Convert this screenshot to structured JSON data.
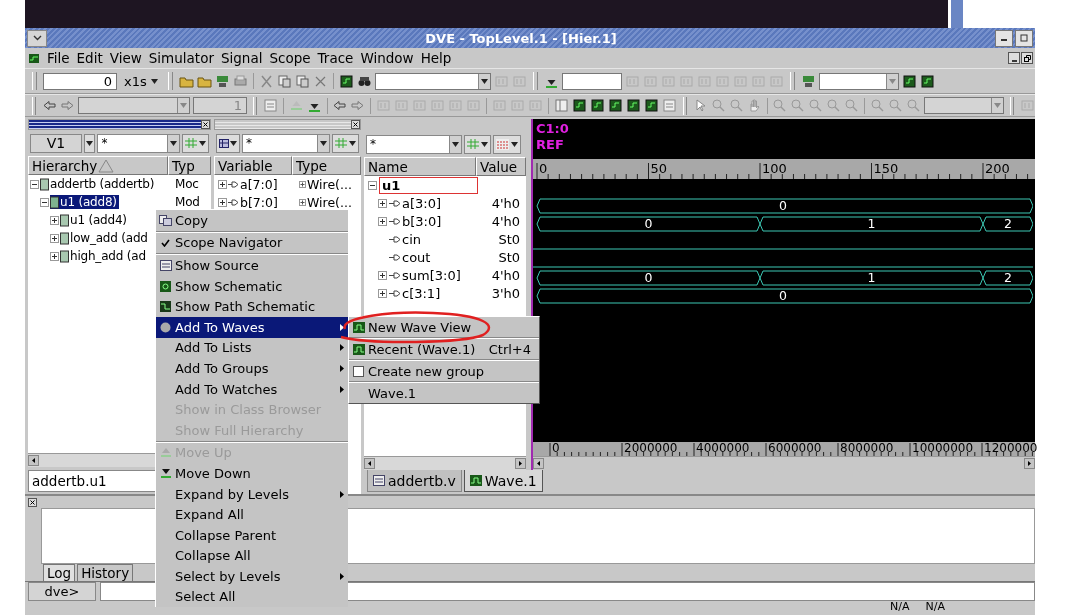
{
  "window": {
    "title": "DVE - TopLevel.1 - [Hier.1]"
  },
  "menu_bar": [
    "File",
    "Edit",
    "View",
    "Simulator",
    "Signal",
    "Scope",
    "Trace",
    "Window",
    "Help"
  ],
  "toolbar": {
    "time": "0",
    "time_unit": "x1s",
    "step_count": "1"
  },
  "hierarchy_panel": {
    "view_button": "V1",
    "filter": "*",
    "columns": [
      "Hierarchy",
      "Typ"
    ],
    "tree": [
      {
        "name": "addertb (addertb)",
        "type": "Moc",
        "expanded": true,
        "selected": false,
        "children": [
          {
            "name": "u1 (add8)",
            "type": "Mod",
            "expanded": true,
            "selected": true,
            "children": [
              {
                "name": "u1 (add4)",
                "expanded": false,
                "selected": false
              },
              {
                "name": "low_add (add",
                "expanded": false,
                "selected": false
              },
              {
                "name": "high_add (ad",
                "expanded": false,
                "selected": false
              }
            ]
          }
        ]
      }
    ],
    "scope_field": "addertb.u1"
  },
  "variable_panel": {
    "filter": "*",
    "columns": [
      "Variable",
      "Type"
    ],
    "rows": [
      {
        "name": "a[7:0]",
        "type": "Wire(..."
      },
      {
        "name": "b[7:0]",
        "type": "Wire(..."
      }
    ]
  },
  "wave_panel": {
    "filter": "*",
    "columns": [
      "Name",
      "Value"
    ],
    "group": {
      "name": "u1",
      "expanded": true
    },
    "signals": [
      {
        "name": "a[3:0]",
        "value": "4'h0",
        "kind": "bus",
        "segments": [
          "0"
        ]
      },
      {
        "name": "b[3:0]",
        "value": "4'h0",
        "kind": "bus",
        "segments": [
          "0",
          "1",
          "2"
        ]
      },
      {
        "name": "cin",
        "value": "St0",
        "kind": "bit"
      },
      {
        "name": "cout",
        "value": "St0",
        "kind": "bit"
      },
      {
        "name": "sum[3:0]",
        "value": "4'h0",
        "kind": "bus",
        "segments": [
          "0",
          "1",
          "2"
        ]
      },
      {
        "name": "c[3:1]",
        "value": "3'h0",
        "kind": "bus",
        "segments": [
          "0"
        ]
      }
    ],
    "cursor": "C1:0",
    "reference": "REF",
    "ruler": [
      "0",
      "50",
      "100",
      "150",
      "200"
    ],
    "overview_ruler": [
      "0",
      "2000000",
      "4000000",
      "6000000",
      "8000000",
      "10000000",
      "1200000"
    ],
    "tabs": [
      {
        "label": "addertb.v",
        "selected": false
      },
      {
        "label": "Wave.1",
        "selected": true
      }
    ]
  },
  "console": {
    "tabs": [
      {
        "label": "Log",
        "selected": true
      },
      {
        "label": "History",
        "selected": false
      }
    ],
    "prompt": "dve>"
  },
  "status_bar": [
    "N/A",
    "N/A"
  ],
  "context_menu": {
    "groups": [
      [
        {
          "label": "Copy",
          "checked": false,
          "disabled": false,
          "selected": false,
          "submenu": false
        }
      ],
      [
        {
          "label": "Scope Navigator",
          "checked": true,
          "disabled": false,
          "selected": false,
          "submenu": false
        }
      ],
      [
        {
          "label": "Show Source",
          "checked": false,
          "disabled": false,
          "selected": false,
          "submenu": false
        },
        {
          "label": "Show Schematic",
          "checked": false,
          "disabled": false,
          "selected": false,
          "submenu": false
        },
        {
          "label": "Show Path Schematic",
          "checked": false,
          "disabled": false,
          "selected": false,
          "submenu": false
        },
        {
          "label": "Add To Waves",
          "checked": false,
          "disabled": false,
          "selected": true,
          "submenu": true
        },
        {
          "label": "Add To Lists",
          "checked": false,
          "disabled": false,
          "selected": false,
          "submenu": true
        },
        {
          "label": "Add To Groups",
          "checked": false,
          "disabled": false,
          "selected": false,
          "submenu": true
        },
        {
          "label": "Add To Watches",
          "checked": false,
          "disabled": false,
          "selected": false,
          "submenu": true
        },
        {
          "label": "Show in Class Browser",
          "checked": false,
          "disabled": true,
          "selected": false,
          "submenu": false
        },
        {
          "label": "Show Full Hierarchy",
          "checked": false,
          "disabled": true,
          "selected": false,
          "submenu": false
        }
      ],
      [
        {
          "label": "Move Up",
          "checked": false,
          "disabled": true,
          "selected": false,
          "submenu": false
        },
        {
          "label": "Move Down",
          "checked": false,
          "disabled": false,
          "selected": false,
          "submenu": false
        },
        {
          "label": "Expand by Levels",
          "checked": false,
          "disabled": false,
          "selected": false,
          "submenu": true
        },
        {
          "label": "Expand All",
          "checked": false,
          "disabled": false,
          "selected": false,
          "submenu": false
        },
        {
          "label": "Collapse Parent",
          "checked": false,
          "disabled": false,
          "selected": false,
          "submenu": false
        },
        {
          "label": "Collapse All",
          "checked": false,
          "disabled": false,
          "selected": false,
          "submenu": false
        },
        {
          "label": "Select by Levels",
          "checked": false,
          "disabled": false,
          "selected": false,
          "submenu": true
        },
        {
          "label": "Select All",
          "checked": false,
          "disabled": false,
          "selected": false,
          "submenu": false
        }
      ]
    ]
  },
  "submenu": {
    "items": [
      {
        "label": "New Wave View",
        "kind": "wave",
        "checked": false
      },
      {
        "label": "Recent (Wave.1)",
        "shortcut": "Ctrl+4",
        "kind": "wave",
        "checked": false
      },
      {
        "label": "Create new group",
        "kind": "checkbox",
        "checked": false
      },
      {
        "label": "Wave.1",
        "kind": "plain",
        "checked": false
      }
    ]
  }
}
